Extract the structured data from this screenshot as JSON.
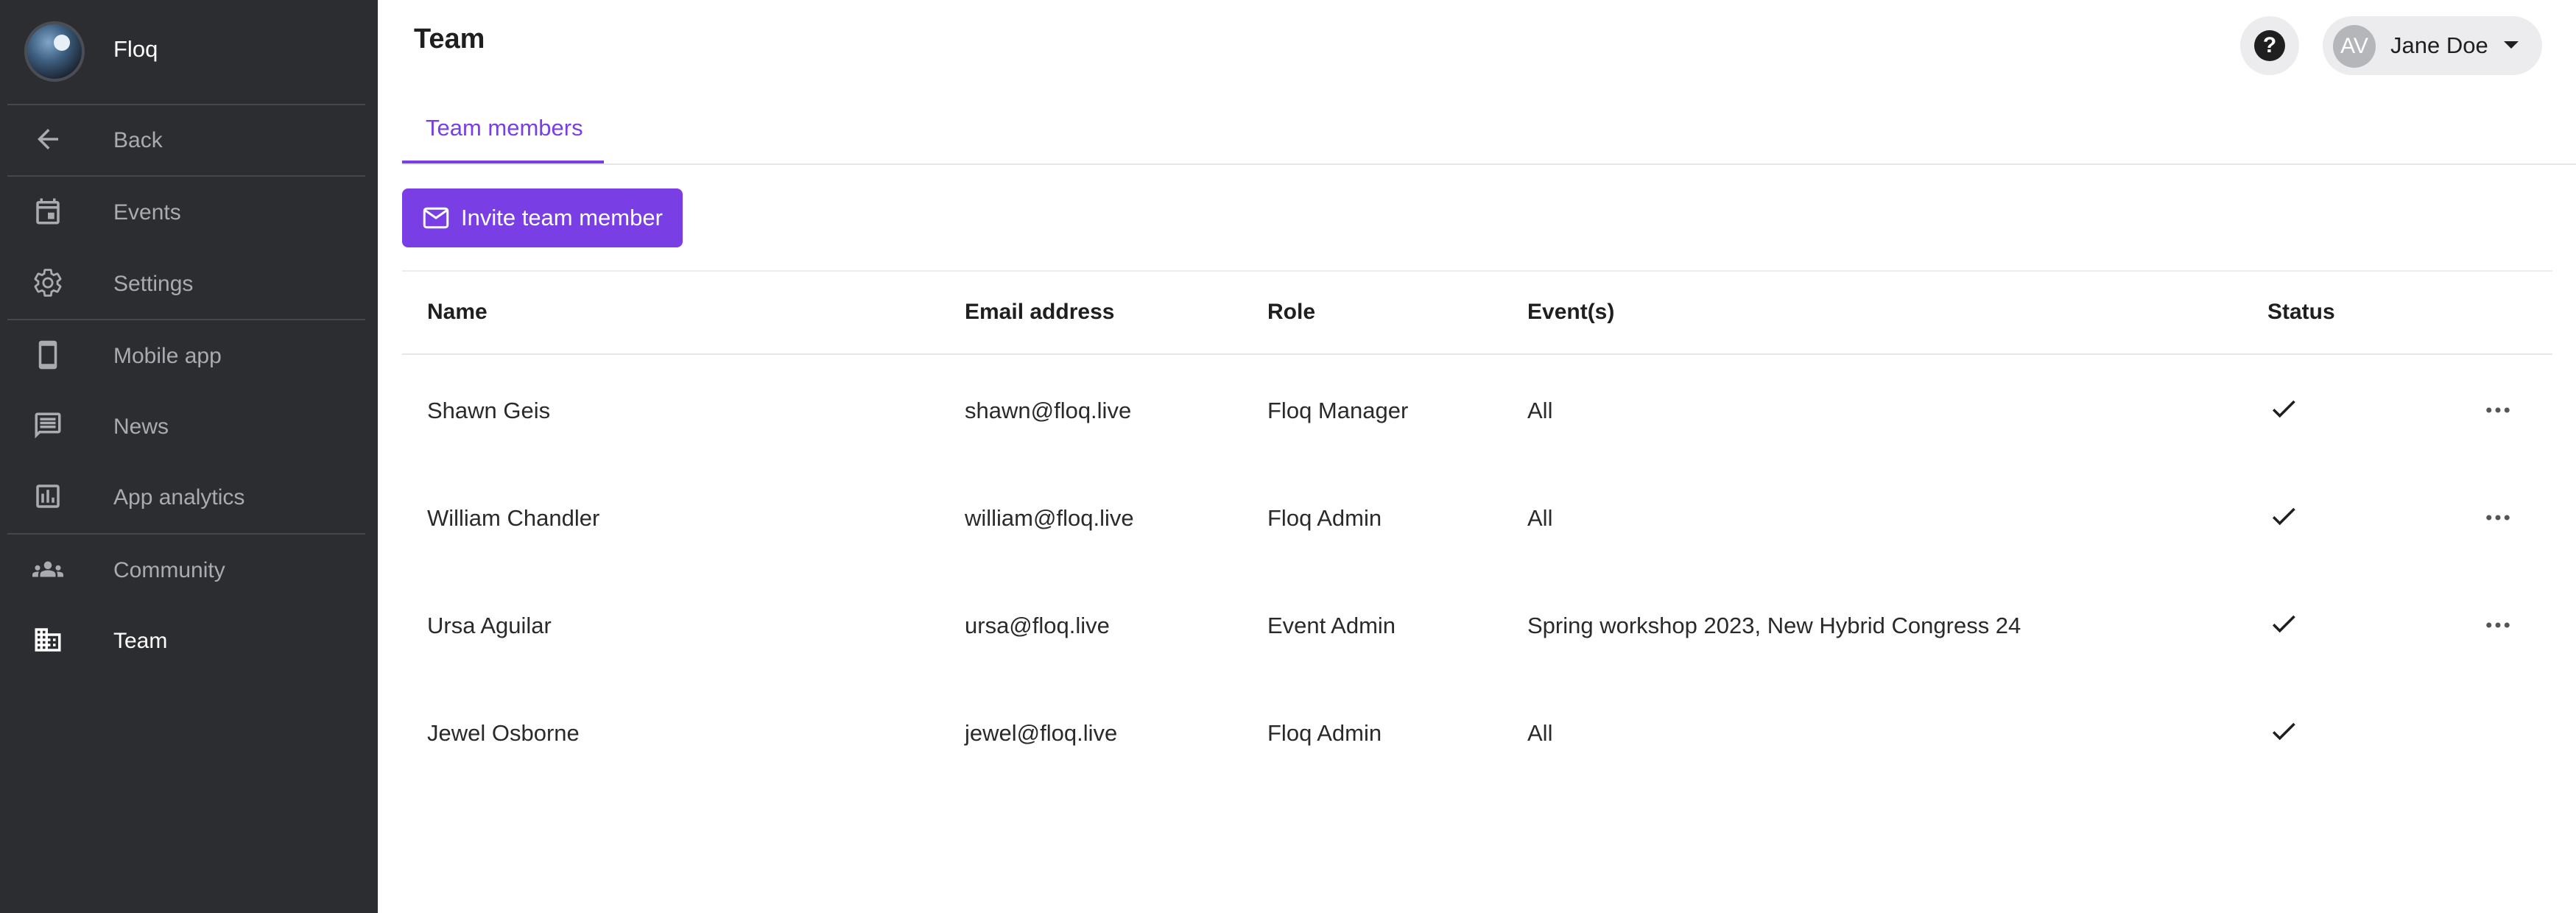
{
  "app": {
    "name": "Floq"
  },
  "sidebar": {
    "items": [
      {
        "label": "Back",
        "icon": "arrow-back-icon"
      },
      {
        "label": "Events",
        "icon": "calendar-icon"
      },
      {
        "label": "Settings",
        "icon": "gear-icon"
      },
      {
        "label": "Mobile app",
        "icon": "smartphone-icon"
      },
      {
        "label": "News",
        "icon": "chat-message-icon"
      },
      {
        "label": "App analytics",
        "icon": "bar-chart-icon"
      },
      {
        "label": "Community",
        "icon": "group-icon"
      },
      {
        "label": "Team",
        "icon": "building-icon"
      }
    ],
    "active": "Team"
  },
  "header": {
    "title": "Team",
    "help_label": "?",
    "user": {
      "initials": "AV",
      "name": "Jane Doe"
    }
  },
  "tabs": [
    {
      "label": "Team members",
      "active": true
    }
  ],
  "actions": {
    "invite_label": "Invite team member"
  },
  "table": {
    "columns": [
      "Name",
      "Email address",
      "Role",
      "Event(s)",
      "Status"
    ],
    "rows": [
      {
        "name": "Shawn Geis",
        "email": "shawn@floq.live",
        "role": "Floq Manager",
        "events": "All",
        "status": "active",
        "has_menu": true
      },
      {
        "name": "William Chandler",
        "email": "william@floq.live",
        "role": "Floq Admin",
        "events": "All",
        "status": "active",
        "has_menu": true
      },
      {
        "name": "Ursa Aguilar",
        "email": "ursa@floq.live",
        "role": "Event Admin",
        "events": "Spring workshop 2023, New Hybrid Congress 24",
        "status": "active",
        "has_menu": true
      },
      {
        "name": "Jewel Osborne",
        "email": "jewel@floq.live",
        "role": "Floq Admin",
        "events": "All",
        "status": "active",
        "has_menu": false
      }
    ]
  },
  "colors": {
    "sidebar_bg": "#2c2d31",
    "accent": "#7a3fe4",
    "sidebar_text": "#a9abb1"
  }
}
